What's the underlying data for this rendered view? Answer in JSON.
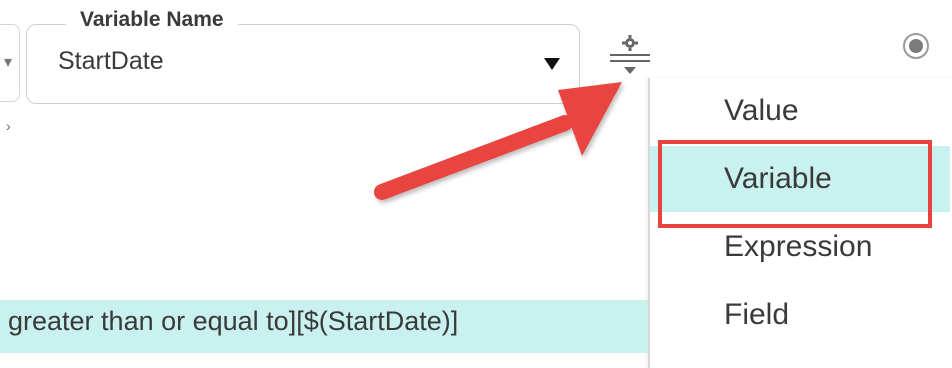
{
  "variable_field": {
    "legend": "Variable Name",
    "value": "StartDate"
  },
  "menu": {
    "items": [
      {
        "label": "Value",
        "selected": false
      },
      {
        "label": "Variable",
        "selected": true
      },
      {
        "label": "Expression",
        "selected": false
      },
      {
        "label": "Field",
        "selected": false
      }
    ]
  },
  "filter": {
    "text": "greater than or equal to][$(StartDate)]"
  },
  "colors": {
    "highlight": "#c9f1ef",
    "annotation_red": "#e8443f"
  }
}
